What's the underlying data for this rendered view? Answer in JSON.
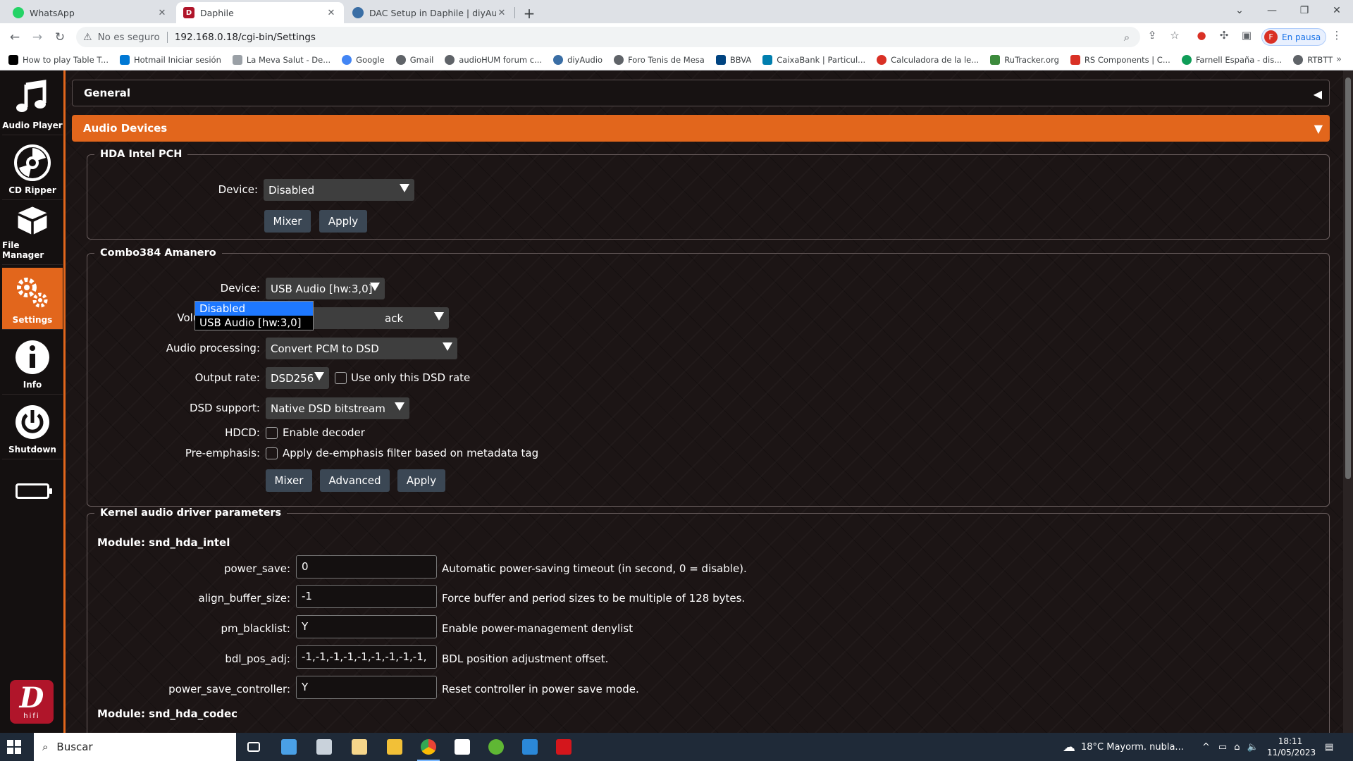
{
  "browser": {
    "tabs": [
      {
        "title": "WhatsApp",
        "color": "#25d366",
        "active": false
      },
      {
        "title": "Daphile",
        "color": "#b0152a",
        "active": true
      },
      {
        "title": "DAC Setup in Daphile | diyAudio",
        "color": "#3a6ea5",
        "active": false
      }
    ],
    "address": {
      "security_label": "No es seguro",
      "url": "192.168.0.18/cgi-bin/Settings"
    },
    "profile": {
      "initial": "F",
      "label": "En pausa"
    },
    "bookmarks": [
      {
        "label": "How to play Table T...",
        "color": "#000000"
      },
      {
        "label": "Hotmail Iniciar sesión",
        "color": "#0078d4"
      },
      {
        "label": "La Meva Salut - De...",
        "color": "#9aa0a6"
      },
      {
        "label": "Google",
        "color": "#4285f4"
      },
      {
        "label": "Gmail",
        "color": "#5f6368"
      },
      {
        "label": "audioHUM forum c...",
        "color": "#5f6368"
      },
      {
        "label": "diyAudio",
        "color": "#3a6ea5"
      },
      {
        "label": "Foro Tenis de Mesa",
        "color": "#5f6368"
      },
      {
        "label": "BBVA",
        "color": "#004481"
      },
      {
        "label": "CaixaBank | Particul...",
        "color": "#007eae"
      },
      {
        "label": "Calculadora de la le...",
        "color": "#d93025"
      },
      {
        "label": "RuTracker.org",
        "color": "#3c8a3c"
      },
      {
        "label": "RS Components | C...",
        "color": "#d93025"
      },
      {
        "label": "Farnell España - dis...",
        "color": "#0f9d58"
      },
      {
        "label": "RTBTT",
        "color": "#5f6368"
      }
    ]
  },
  "nav": {
    "items": [
      {
        "label": "Audio Player",
        "icon": "music-note-icon",
        "active": false
      },
      {
        "label": "CD Ripper",
        "icon": "cd-icon",
        "active": false
      },
      {
        "label": "File Manager",
        "icon": "box-icon",
        "active": false
      },
      {
        "label": "Settings",
        "icon": "gears-icon",
        "active": true
      },
      {
        "label": "Info",
        "icon": "info-icon",
        "active": false
      },
      {
        "label": "Shutdown",
        "icon": "power-icon",
        "active": false
      }
    ],
    "logo_text": "hifi"
  },
  "settings": {
    "general_title": "General",
    "audio_devices_title": "Audio Devices",
    "hda": {
      "legend": "HDA Intel PCH",
      "device_label": "Device:",
      "device_value": "Disabled",
      "mixer": "Mixer",
      "apply": "Apply"
    },
    "combo": {
      "legend": "Combo384 Amanero",
      "device_label": "Device:",
      "device_value": "USB Audio [hw:3,0]",
      "dropdown_options": [
        "Disabled",
        "USB Audio [hw:3,0]"
      ],
      "volume_label": "Volume control:",
      "volume_value_visible": "ack",
      "processing_label": "Audio processing:",
      "processing_value": "Convert PCM to DSD",
      "rate_label": "Output rate:",
      "rate_value": "DSD256",
      "rate_check": "Use only this DSD rate",
      "dsd_label": "DSD support:",
      "dsd_value": "Native DSD bitstream",
      "hdcd_label": "HDCD:",
      "hdcd_check": "Enable decoder",
      "preemph_label": "Pre-emphasis:",
      "preemph_check": "Apply de-emphasis filter based on metadata tag",
      "mixer": "Mixer",
      "advanced": "Advanced",
      "apply": "Apply"
    },
    "kernel": {
      "legend": "Kernel audio driver parameters",
      "module1": "Module: snd_hda_intel",
      "params": [
        {
          "name": "power_save:",
          "value": "0",
          "desc": "Automatic power-saving timeout (in second, 0 = disable)."
        },
        {
          "name": "align_buffer_size:",
          "value": "-1",
          "desc": "Force buffer and period sizes to be multiple of 128 bytes."
        },
        {
          "name": "pm_blacklist:",
          "value": "Y",
          "desc": "Enable power-management denylist"
        },
        {
          "name": "bdl_pos_adj:",
          "value": "-1,-1,-1,-1,-1,-1,-1,-1,-1,",
          "desc": "BDL position adjustment offset."
        },
        {
          "name": "power_save_controller:",
          "value": "Y",
          "desc": "Reset controller in power save mode."
        }
      ],
      "module2": "Module: snd_hda_codec"
    }
  },
  "taskbar": {
    "search_placeholder": "Buscar",
    "weather": "18°C  Mayorm. nubla...",
    "time": "18:11",
    "date": "11/05/2023"
  }
}
